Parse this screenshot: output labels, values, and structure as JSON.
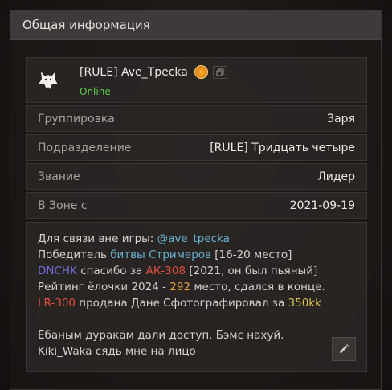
{
  "panel": {
    "title": "Общая информация"
  },
  "profile": {
    "username": "[RULE] Ave_Трecka",
    "status": "Online",
    "badge_icon": "sun-badge-icon",
    "copy_icon": "copy-icon",
    "avatar_icon": "wolf-icon"
  },
  "fields": [
    {
      "label": "Группировка",
      "value": "Заря"
    },
    {
      "label": "Подразделение",
      "value": "[RULE] Тридцать четыре"
    },
    {
      "label": "Звание",
      "value": "Лидер"
    },
    {
      "label": "В Зоне с",
      "value": "2021-09-19"
    }
  ],
  "about": {
    "l1": {
      "a": "Для связи вне игры: ",
      "b": "@ave_tpecka"
    },
    "l2": {
      "a": "Победитель ",
      "b": "битвы Стримеров",
      "c": " [16-20 место]"
    },
    "l3": {
      "a": "DNCHK",
      "b": " спасибо за ",
      "c": "АК-308",
      "d": " [2021, он был пьяный]"
    },
    "l4": {
      "a": "Рейтинг ёлочки 2024 - ",
      "b": "292",
      "c": " место, сдался в конце."
    },
    "l5": {
      "a": "LR-300",
      "b": " продана Дане Сфотографировал за ",
      "c": "350kk"
    },
    "l6": "Ебаным дуракам дали доступ. Бэмс нахуй.",
    "l7": "Kiki_Waka сядь мне на лицо"
  },
  "edit_icon": "pencil-icon"
}
